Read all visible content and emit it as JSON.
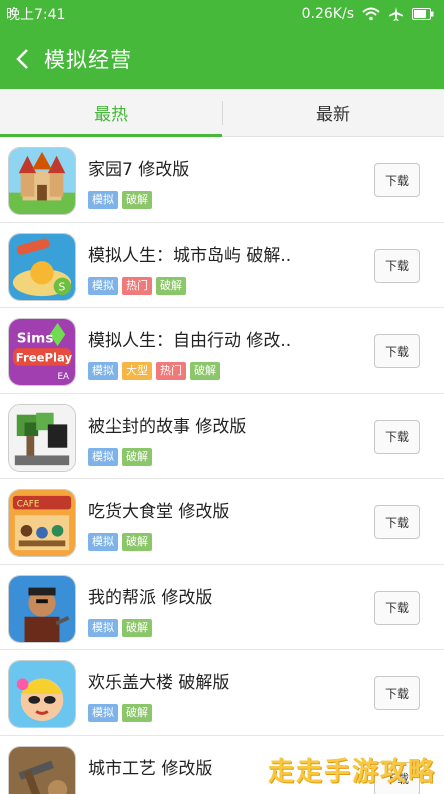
{
  "status": {
    "time": "晚上7:41",
    "speed": "0.26K/s"
  },
  "appbar": {
    "title": "模拟经营"
  },
  "tabs": [
    {
      "label": "最热",
      "active": true
    },
    {
      "label": "最新",
      "active": false
    }
  ],
  "download_label": "下载",
  "colors": {
    "brand_green": "#46b83a",
    "tag_blue": "#7db3e8",
    "tag_green": "#8cc66a",
    "tag_red": "#f07a7a",
    "tag_orange": "#f6b545"
  },
  "games": [
    {
      "title": "家园7  修改版",
      "tags": [
        "模拟",
        "破解"
      ],
      "icon": "castle-game-icon"
    },
    {
      "title": "模拟人生：城市岛屿  破解..",
      "tags": [
        "模拟",
        "热门",
        "破解"
      ],
      "icon": "island-game-icon"
    },
    {
      "title": "模拟人生：自由行动  修改..",
      "tags": [
        "模拟",
        "大型",
        "热门",
        "破解"
      ],
      "icon": "sims-freeplay-icon"
    },
    {
      "title": "被尘封的故事  修改版",
      "tags": [
        "模拟",
        "破解"
      ],
      "icon": "pixel-tree-game-icon"
    },
    {
      "title": "吃货大食堂  修改版",
      "tags": [
        "模拟",
        "破解"
      ],
      "icon": "cafeteria-game-icon"
    },
    {
      "title": "我的帮派  修改版",
      "tags": [
        "模拟",
        "破解"
      ],
      "icon": "gang-game-icon"
    },
    {
      "title": "欢乐盖大楼  破解版",
      "tags": [
        "模拟",
        "破解"
      ],
      "icon": "tower-game-icon"
    },
    {
      "title": "城市工艺  修改版",
      "tags": [],
      "icon": "city-craft-icon"
    }
  ],
  "watermark": "走走手游攻略"
}
